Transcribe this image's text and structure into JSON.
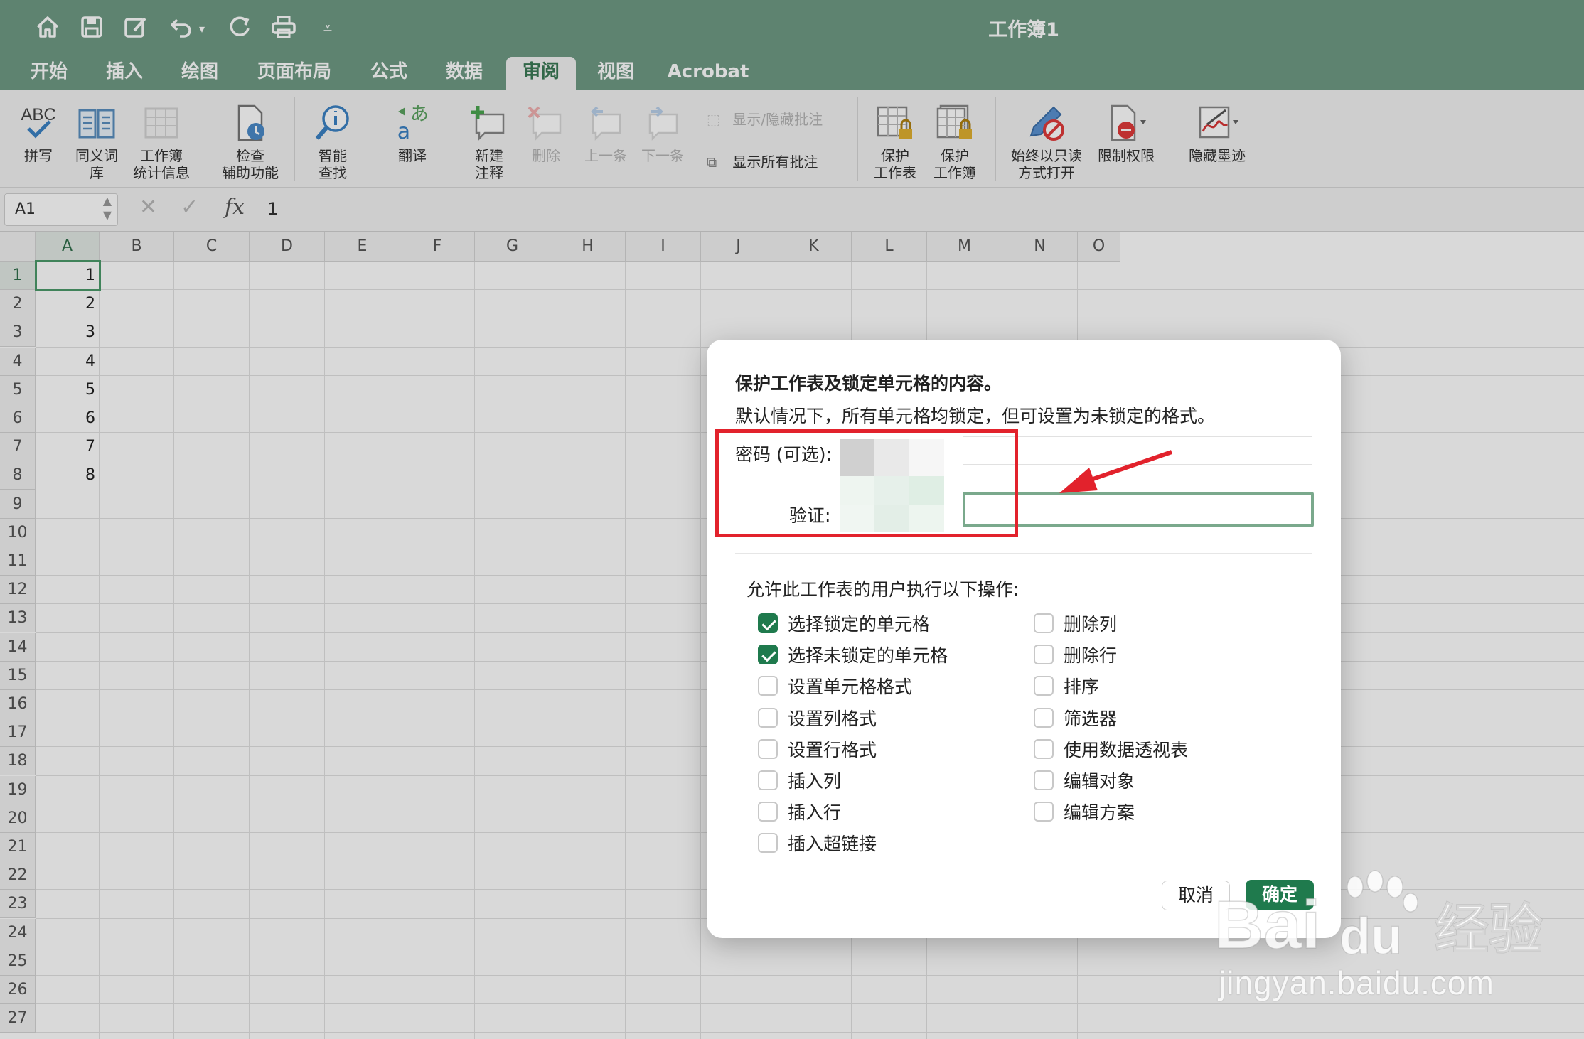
{
  "title_bar": {
    "document_title": "工作簿1",
    "quick_access": [
      "home-icon",
      "save-icon",
      "edit-icon",
      "undo-icon",
      "redo-icon",
      "print-icon",
      "customize-icon"
    ]
  },
  "tabs": [
    {
      "label": "开始",
      "active": false
    },
    {
      "label": "插入",
      "active": false
    },
    {
      "label": "绘图",
      "active": false
    },
    {
      "label": "页面布局",
      "active": false
    },
    {
      "label": "公式",
      "active": false
    },
    {
      "label": "数据",
      "active": false
    },
    {
      "label": "审阅",
      "active": true
    },
    {
      "label": "视图",
      "active": false
    },
    {
      "label": "Acrobat",
      "active": false
    }
  ],
  "ribbon": {
    "spelling": "拼写",
    "spelling_icon_text": "ABC",
    "thesaurus": [
      "同义词",
      "库"
    ],
    "workbook_stats": [
      "工作簿",
      "统计信息"
    ],
    "accessibility": [
      "检查",
      "辅助功能"
    ],
    "smart_lookup": [
      "智能",
      "查找"
    ],
    "translate": "翻译",
    "translate_icon_a": "あ",
    "translate_icon_b": "a",
    "new_comment": [
      "新建",
      "注释"
    ],
    "delete": "删除",
    "previous": "上一条",
    "next": "下一条",
    "show_hide_comments": "显示/隐藏批注",
    "show_all_comments": "显示所有批注",
    "protect_sheet": [
      "保护",
      "工作表"
    ],
    "protect_workbook": [
      "保护",
      "工作簿"
    ],
    "always_open_readonly": [
      "始终以只读",
      "方式打开"
    ],
    "restrict_permission": "限制权限",
    "hide_ink": "隐藏墨迹"
  },
  "formula_bar": {
    "name_box": "A1",
    "fx_label": "fx",
    "value": "1"
  },
  "grid": {
    "columns": [
      "A",
      "B",
      "C",
      "D",
      "E",
      "F",
      "G",
      "H",
      "I",
      "J",
      "K",
      "L",
      "M",
      "N",
      "O"
    ],
    "rows": [
      "1",
      "2",
      "3",
      "4",
      "5",
      "6",
      "7",
      "8",
      "9",
      "10",
      "11",
      "12",
      "13",
      "14",
      "15",
      "16",
      "17",
      "18",
      "19",
      "20",
      "21",
      "22",
      "23",
      "24",
      "25",
      "26",
      "27"
    ],
    "column_a_values": [
      "1",
      "2",
      "3",
      "4",
      "5",
      "6",
      "7",
      "8"
    ],
    "active_cell": "A1"
  },
  "dialog": {
    "heading": "保护工作表及锁定单元格的内容。",
    "description": "默认情况下，所有单元格均锁定，但可设置为未锁定的格式。",
    "password_label": "密码 (可选):",
    "verify_label": "验证:",
    "permissions_heading": "允许此工作表的用户执行以下操作:",
    "left_options": [
      {
        "label": "选择锁定的单元格",
        "checked": true
      },
      {
        "label": "选择未锁定的单元格",
        "checked": true
      },
      {
        "label": "设置单元格格式",
        "checked": false
      },
      {
        "label": "设置列格式",
        "checked": false
      },
      {
        "label": "设置行格式",
        "checked": false
      },
      {
        "label": "插入列",
        "checked": false
      },
      {
        "label": "插入行",
        "checked": false
      },
      {
        "label": "插入超链接",
        "checked": false
      }
    ],
    "right_options": [
      {
        "label": "删除列",
        "checked": false
      },
      {
        "label": "删除行",
        "checked": false
      },
      {
        "label": "排序",
        "checked": false
      },
      {
        "label": "筛选器",
        "checked": false
      },
      {
        "label": "使用数据透视表",
        "checked": false
      },
      {
        "label": "编辑对象",
        "checked": false
      },
      {
        "label": "编辑方案",
        "checked": false
      }
    ],
    "cancel_label": "取消",
    "ok_label": "确定"
  },
  "colors": {
    "title_bar": "#6f9a84",
    "accent": "#1f7a4d",
    "highlight_box": "#e2222c",
    "arrow": "#e2222c"
  },
  "watermark": {
    "logo_text": "Bai",
    "logo_text2": "du",
    "logo_cn": "经验",
    "url": "jingyan.baidu.com"
  }
}
